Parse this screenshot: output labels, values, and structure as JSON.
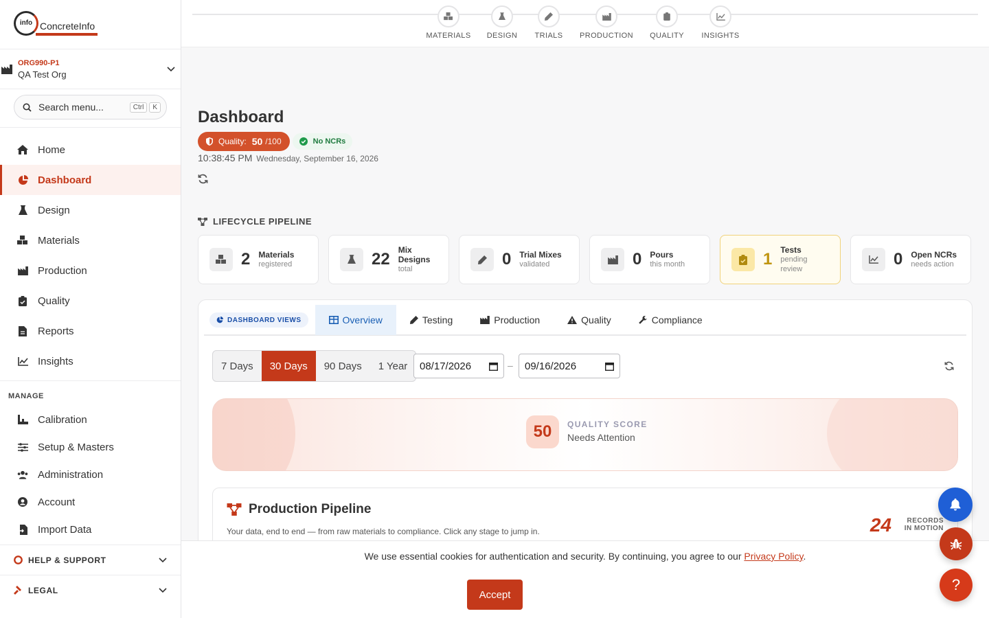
{
  "brand": {
    "logo_inner": "info",
    "logo_text": "ConcreteInfo",
    "accent": "#c4391a"
  },
  "org": {
    "code": "ORG990-P1",
    "name": "QA Test Org"
  },
  "search": {
    "placeholder": "Search menu...",
    "kbd1": "Ctrl",
    "kbd2": "K"
  },
  "nav": {
    "items": [
      {
        "label": "Home",
        "icon": "home-icon"
      },
      {
        "label": "Dashboard",
        "icon": "pie-chart-icon",
        "active": true
      },
      {
        "label": "Design",
        "icon": "flask-icon"
      },
      {
        "label": "Materials",
        "icon": "cubes-icon"
      },
      {
        "label": "Production",
        "icon": "factory-icon"
      },
      {
        "label": "Quality",
        "icon": "clipboard-check-icon"
      },
      {
        "label": "Reports",
        "icon": "file-icon"
      },
      {
        "label": "Insights",
        "icon": "line-chart-icon"
      }
    ],
    "manage_title": "MANAGE",
    "manage": [
      {
        "label": "Calibration",
        "icon": "calibration-icon"
      },
      {
        "label": "Setup & Masters",
        "icon": "sliders-icon"
      },
      {
        "label": "Administration",
        "icon": "users-icon"
      },
      {
        "label": "Account",
        "icon": "user-circle-icon"
      },
      {
        "label": "Import Data",
        "icon": "file-import-icon"
      }
    ],
    "help": "HELP & SUPPORT",
    "legal": "LEGAL"
  },
  "stepper": [
    "MATERIALS",
    "DESIGN",
    "TRIALS",
    "PRODUCTION",
    "QUALITY",
    "INSIGHTS"
  ],
  "page": {
    "title": "Dashboard",
    "quality_label": "Quality:",
    "quality_value": "50",
    "quality_max": "/100",
    "ncr_label": "No NCRs",
    "time": "10:38:45 PM",
    "date": "Wednesday, September 16, 2026"
  },
  "lifecycle": {
    "title": "LIFECYCLE PIPELINE",
    "cards": [
      {
        "value": "2",
        "label": "Materials",
        "sub": "registered"
      },
      {
        "value": "22",
        "label": "Mix Designs",
        "sub": "total"
      },
      {
        "value": "0",
        "label": "Trial Mixes",
        "sub": "validated"
      },
      {
        "value": "0",
        "label": "Pours",
        "sub": "this month"
      },
      {
        "value": "1",
        "label": "Tests",
        "sub": "pending review"
      },
      {
        "value": "0",
        "label": "Open NCRs",
        "sub": "needs action"
      }
    ]
  },
  "views": {
    "badge": "DASHBOARD VIEWS",
    "tabs": [
      "Overview",
      "Testing",
      "Production",
      "Quality",
      "Compliance"
    ],
    "ranges": [
      "7 Days",
      "30 Days",
      "90 Days",
      "1 Year"
    ],
    "date_from": "08/17/2026",
    "date_to": "09/16/2026"
  },
  "quality_score": {
    "value": "50",
    "label": "QUALITY SCORE",
    "status": "Needs Attention"
  },
  "pipeline": {
    "title": "Production Pipeline",
    "subtitle": "Your data, end to end — from raw materials to compliance. Click any stage to jump in.",
    "count": "24",
    "count_label_1": "RECORDS",
    "count_label_2": "IN MOTION"
  },
  "cookie": {
    "text": "We use essential cookies for authentication and security. By continuing, you agree to our",
    "link": "Privacy Policy",
    "end": ".",
    "accept": "Accept"
  },
  "fab": {
    "help": "?"
  }
}
